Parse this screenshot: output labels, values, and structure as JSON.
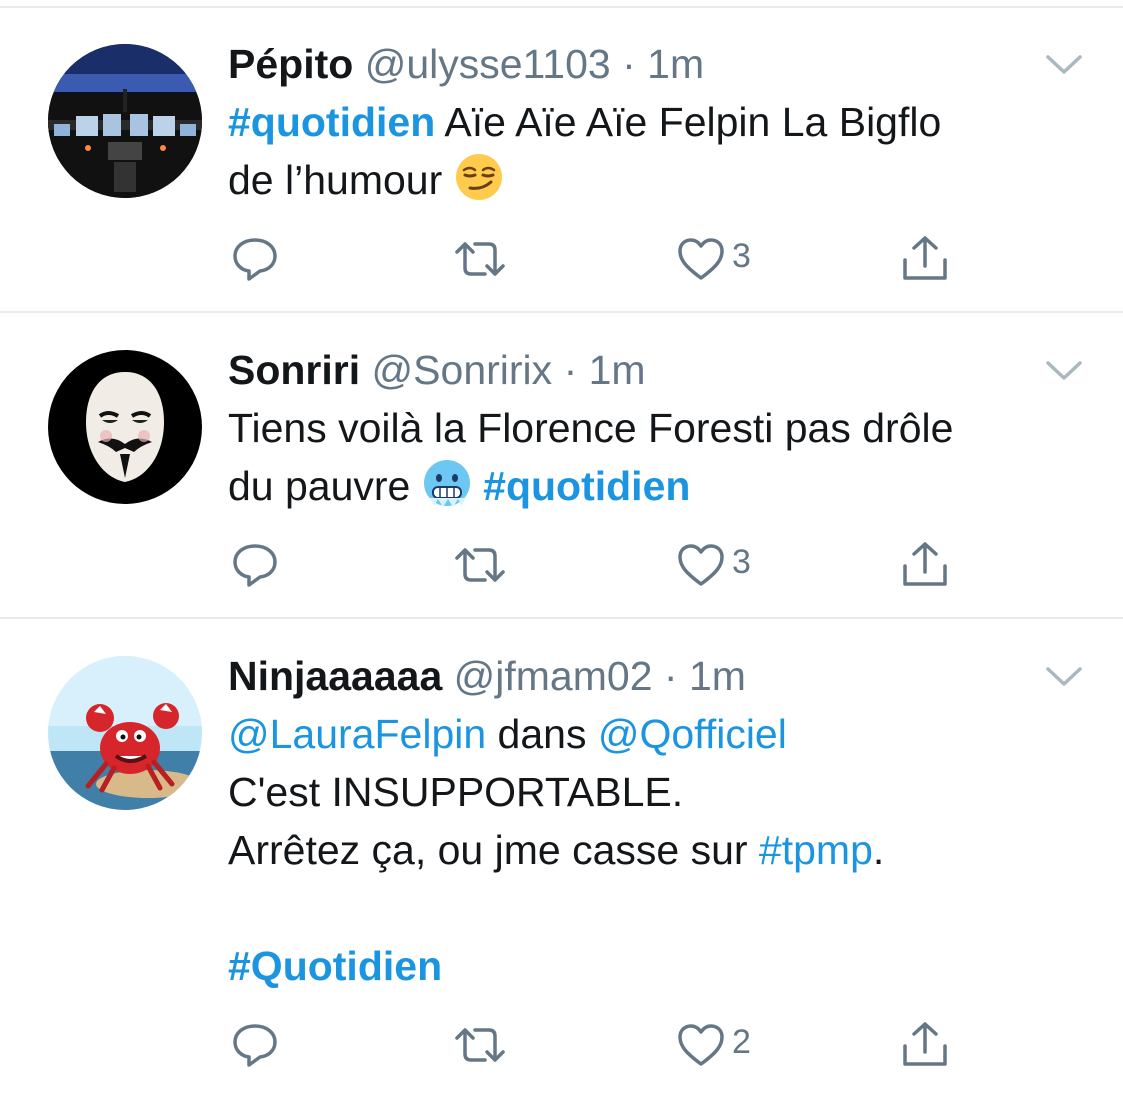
{
  "tweets": [
    {
      "name": "Pépito",
      "handle": "@ulysse1103",
      "dot": "·",
      "time": "1m",
      "avatar_icon": "cockpit-avatar",
      "likes": "3",
      "lines": {
        "l1_tag": "#quotidien",
        "l1_text": " Aïe Aïe Aïe Felpin La Bigflo",
        "l2_text": "de l’humour ",
        "l2_emoji": "smirking-face-emoji"
      }
    },
    {
      "name": "Sonriri",
      "handle": "@Sonririx",
      "dot": "·",
      "time": "1m",
      "avatar_icon": "guy-fawkes-mask-avatar",
      "likes": "3",
      "lines": {
        "l1_text": "Tiens voilà la Florence Foresti pas drôle",
        "l2_text": "du pauvre ",
        "l2_emoji": "cold-face-emoji",
        "l2_tag": "#quotidien"
      }
    },
    {
      "name": "Ninjaaaaaa",
      "handle": "@jfmam02",
      "dot": "·",
      "time": "1m",
      "avatar_icon": "cartoon-crab-avatar",
      "likes": "2",
      "lines": {
        "l1_mention1": "@LauraFelpin",
        "l1_text": " dans ",
        "l1_mention2": "@Qofficiel",
        "l2_text": "C'est INSUPPORTABLE.",
        "l3_text": "Arrêtez ça, ou jme casse sur ",
        "l3_tag": "#tpmp",
        "l3_end": ".",
        "l5_tag": "#Quotidien"
      }
    }
  ],
  "icons": {
    "reply": "reply-icon",
    "retweet": "retweet-icon",
    "like": "heart-icon",
    "share": "share-icon",
    "caret": "chevron-down-icon"
  },
  "colors": {
    "link": "#1b95e0",
    "secondary_text": "#657786",
    "divider": "#e6ecf0",
    "primary_text": "#14171a"
  }
}
